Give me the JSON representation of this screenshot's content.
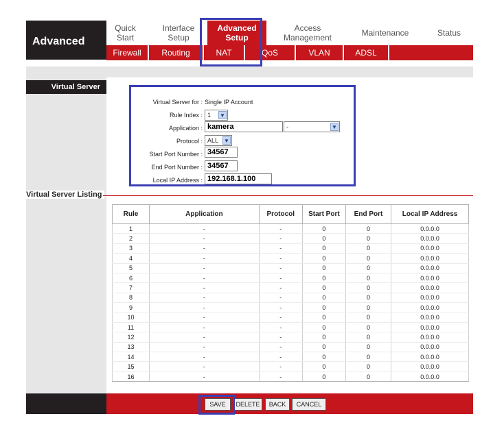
{
  "brand": "Advanced",
  "main_tabs": [
    {
      "label": "Quick\nStart"
    },
    {
      "label": "Interface\nSetup"
    },
    {
      "label": "Advanced\nSetup"
    },
    {
      "label": "Access\nManagement"
    },
    {
      "label": "Maintenance"
    },
    {
      "label": "Status"
    }
  ],
  "sub_tabs": [
    {
      "label": "Firewall"
    },
    {
      "label": "Routing"
    },
    {
      "label": "NAT"
    },
    {
      "label": "QoS"
    },
    {
      "label": "VLAN"
    },
    {
      "label": "ADSL"
    }
  ],
  "section_virtual_server": "Virtual Server",
  "section_listing": "Virtual Server Listing",
  "form": {
    "vs_for_label": "Virtual Server for :",
    "vs_for_value": "Single IP Account",
    "rule_index_label": "Rule Index :",
    "rule_index_value": "1",
    "application_label": "Application :",
    "application_value": "kamera",
    "application_select": "-",
    "protocol_label": "Protocol :",
    "protocol_value": "ALL",
    "start_port_label": "Start Port Number :",
    "start_port_value": "34567",
    "end_port_label": "End Port Number :",
    "end_port_value": "34567",
    "local_ip_label": "Local IP Address :",
    "local_ip_value": "192.168.1.100"
  },
  "table": {
    "headers": [
      "Rule",
      "Application",
      "Protocol",
      "Start Port",
      "End Port",
      "Local IP Address"
    ],
    "rows": [
      [
        "1",
        "-",
        "-",
        "0",
        "0",
        "0.0.0.0"
      ],
      [
        "2",
        "-",
        "-",
        "0",
        "0",
        "0.0.0.0"
      ],
      [
        "3",
        "-",
        "-",
        "0",
        "0",
        "0.0.0.0"
      ],
      [
        "4",
        "-",
        "-",
        "0",
        "0",
        "0.0.0.0"
      ],
      [
        "5",
        "-",
        "-",
        "0",
        "0",
        "0.0.0.0"
      ],
      [
        "6",
        "-",
        "-",
        "0",
        "0",
        "0.0.0.0"
      ],
      [
        "7",
        "-",
        "-",
        "0",
        "0",
        "0.0.0.0"
      ],
      [
        "8",
        "-",
        "-",
        "0",
        "0",
        "0.0.0.0"
      ],
      [
        "9",
        "-",
        "-",
        "0",
        "0",
        "0.0.0.0"
      ],
      [
        "10",
        "-",
        "-",
        "0",
        "0",
        "0.0.0.0"
      ],
      [
        "11",
        "-",
        "-",
        "0",
        "0",
        "0.0.0.0"
      ],
      [
        "12",
        "-",
        "-",
        "0",
        "0",
        "0.0.0.0"
      ],
      [
        "13",
        "-",
        "-",
        "0",
        "0",
        "0.0.0.0"
      ],
      [
        "14",
        "-",
        "-",
        "0",
        "0",
        "0.0.0.0"
      ],
      [
        "15",
        "-",
        "-",
        "0",
        "0",
        "0.0.0.0"
      ],
      [
        "16",
        "-",
        "-",
        "0",
        "0",
        "0.0.0.0"
      ]
    ]
  },
  "buttons": {
    "save": "SAVE",
    "delete": "DELETE",
    "back": "BACK",
    "cancel": "CANCEL"
  },
  "colors": {
    "brand_red": "#c4161c",
    "dark": "#231f20",
    "highlight": "#3b3fb4"
  }
}
